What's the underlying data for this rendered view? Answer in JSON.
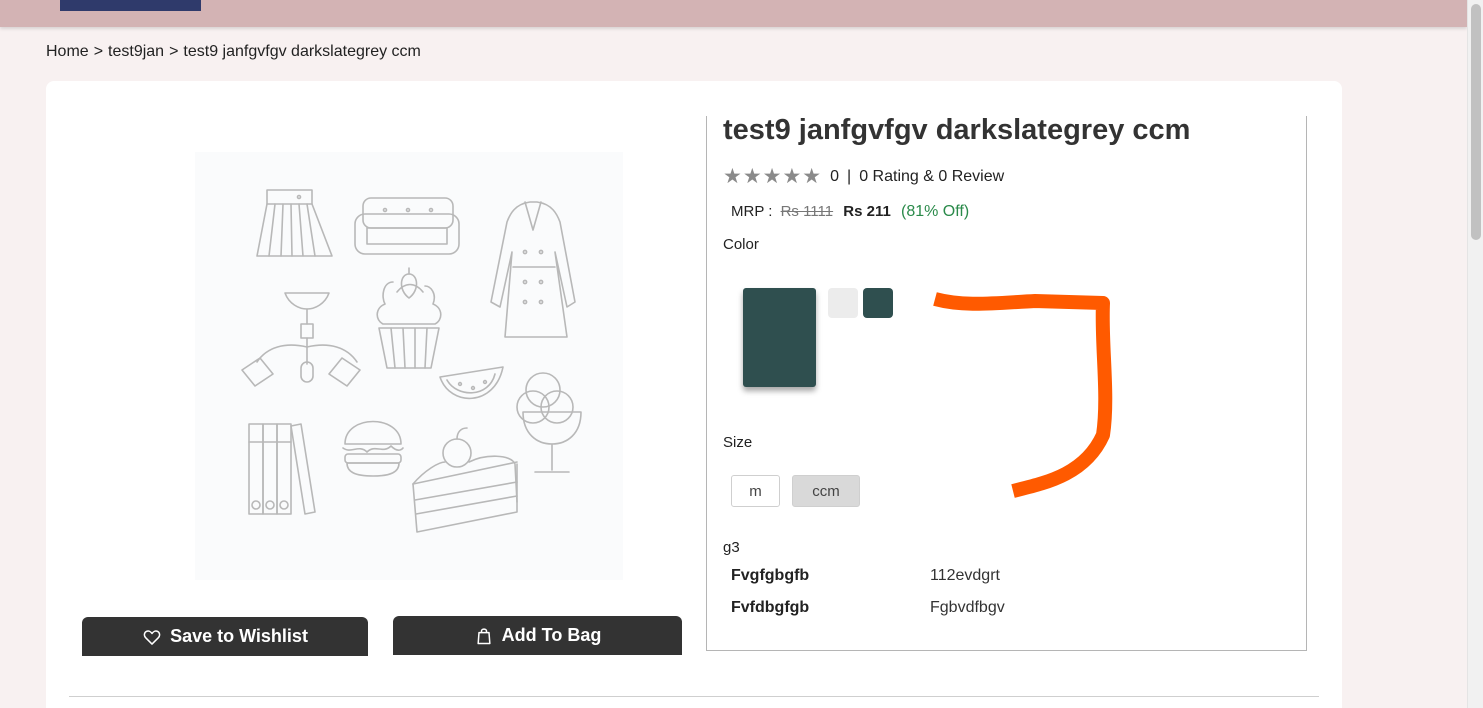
{
  "colors": {
    "topbar": "#d3b3b4",
    "logo_block": "#2f3a6b",
    "page_bg": "#f8f1f1",
    "button_bg": "#333333",
    "selected_color": "#2f4f4f",
    "swatch_light": "#ececec",
    "discount_green": "#2a8a4a",
    "annotation_stroke": "#ff5a00"
  },
  "breadcrumb": {
    "home": "Home",
    "category": "test9jan",
    "current": "test9 janfgvfgv darkslategrey ccm",
    "separator": ">"
  },
  "product": {
    "title": "test9 janfgvfgv darkslategrey ccm",
    "rating_value": "0",
    "rating_stars": "★★★★★",
    "rating_text": "0 Rating & 0 Review",
    "mrp_label": "MRP :",
    "mrp_old": "Rs 1111",
    "price": "Rs 211",
    "discount": "(81% Off)"
  },
  "color_section": {
    "label": "Color",
    "swatches": [
      "#ececec",
      "#2f4f4f"
    ]
  },
  "size_section": {
    "label": "Size",
    "options": [
      "m",
      "ccm"
    ],
    "selected": "ccm"
  },
  "specs": {
    "group": "g3",
    "rows": [
      {
        "key": "Fvgfgbgfb",
        "value": "112evdgrt"
      },
      {
        "key": "Fvfdbgfgb",
        "value": "Fgbvdfbgv"
      }
    ]
  },
  "actions": {
    "wishlist_label": "Save to Wishlist",
    "bag_label": "Add To Bag",
    "wishlist_icon": "heart-icon",
    "bag_icon": "shopping-bag-icon"
  }
}
